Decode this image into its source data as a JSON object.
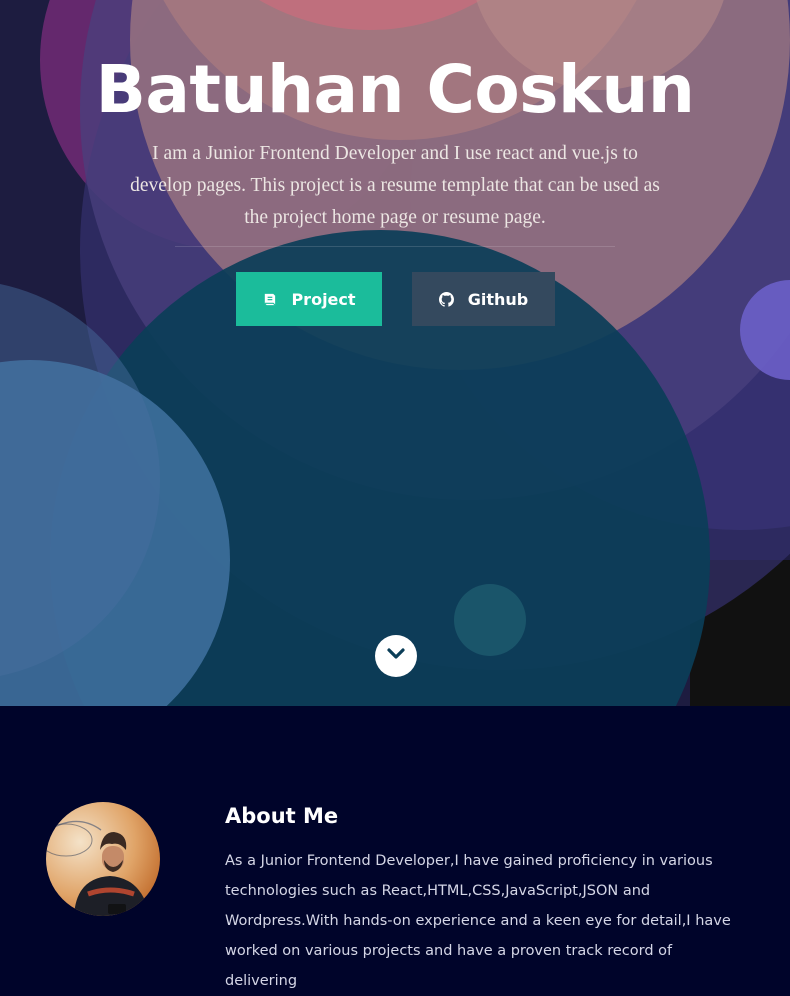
{
  "hero": {
    "title": "Batuhan Coskun",
    "description": "I am a Junior Frontend Developer and I use react and vue.js to develop pages. This project is a resume template that can be used as the project home page or resume page.",
    "buttons": {
      "project": {
        "label": "Project",
        "icon": "book-icon",
        "color": "#1bbc9b"
      },
      "github": {
        "label": "Github",
        "icon": "github-icon",
        "color": "#34495e"
      }
    },
    "scroll_icon": "chevron-down-icon"
  },
  "about": {
    "title": "About Me",
    "text": "As a Junior Frontend Developer,I have gained proficiency in various technologies such as React,HTML,CSS,JavaScript,JSON and Wordpress.With hands-on experience and a keen eye for detail,I have worked on various projects and have a proven track record of delivering"
  },
  "colors": {
    "accent": "#1bbc9b",
    "secondary": "#34495e",
    "background_dark": "#00042a"
  }
}
